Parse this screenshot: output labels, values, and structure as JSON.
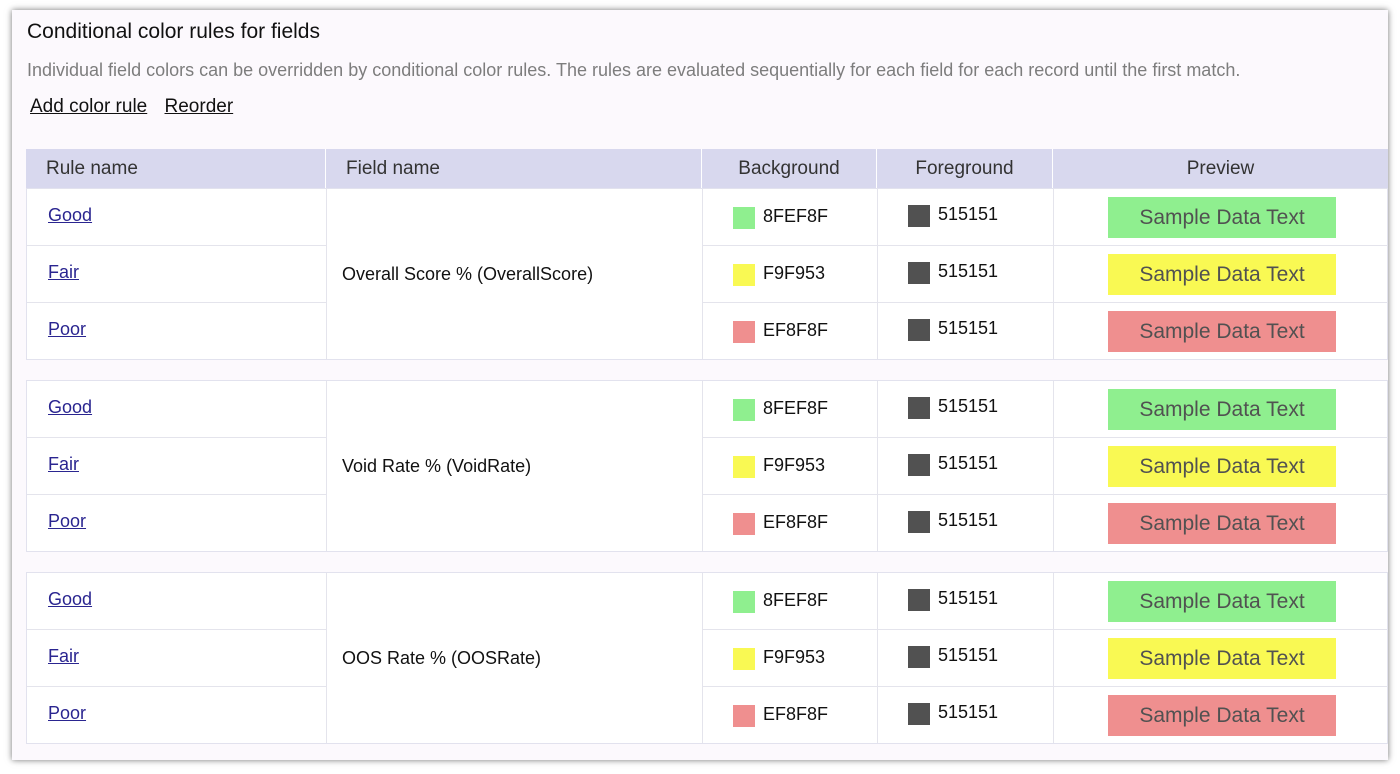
{
  "title": "Conditional color rules for fields",
  "description": "Individual field colors can be overridden by conditional color rules. The rules are evaluated sequentially for each field for each record until the first match.",
  "actions": {
    "add_rule": "Add color rule",
    "reorder": "Reorder"
  },
  "columns": {
    "rule_name": "Rule name",
    "field_name": "Field name",
    "background": "Background",
    "foreground": "Foreground",
    "preview": "Preview"
  },
  "groups": [
    {
      "field": "Overall Score % (OverallScore)",
      "rules": [
        {
          "name": "Good",
          "bg": "8FEF8F",
          "fg": "515151",
          "preview": "Sample Data Text"
        },
        {
          "name": "Fair",
          "bg": "F9F953",
          "fg": "515151",
          "preview": "Sample Data Text"
        },
        {
          "name": "Poor",
          "bg": "EF8F8F",
          "fg": "515151",
          "preview": "Sample Data Text"
        }
      ]
    },
    {
      "field": "Void Rate % (VoidRate)",
      "rules": [
        {
          "name": "Good",
          "bg": "8FEF8F",
          "fg": "515151",
          "preview": "Sample Data Text"
        },
        {
          "name": "Fair",
          "bg": "F9F953",
          "fg": "515151",
          "preview": "Sample Data Text"
        },
        {
          "name": "Poor",
          "bg": "EF8F8F",
          "fg": "515151",
          "preview": "Sample Data Text"
        }
      ]
    },
    {
      "field": "OOS Rate % (OOSRate)",
      "rules": [
        {
          "name": "Good",
          "bg": "8FEF8F",
          "fg": "515151",
          "preview": "Sample Data Text"
        },
        {
          "name": "Fair",
          "bg": "F9F953",
          "fg": "515151",
          "preview": "Sample Data Text"
        },
        {
          "name": "Poor",
          "bg": "EF8F8F",
          "fg": "515151",
          "preview": "Sample Data Text"
        }
      ]
    }
  ]
}
